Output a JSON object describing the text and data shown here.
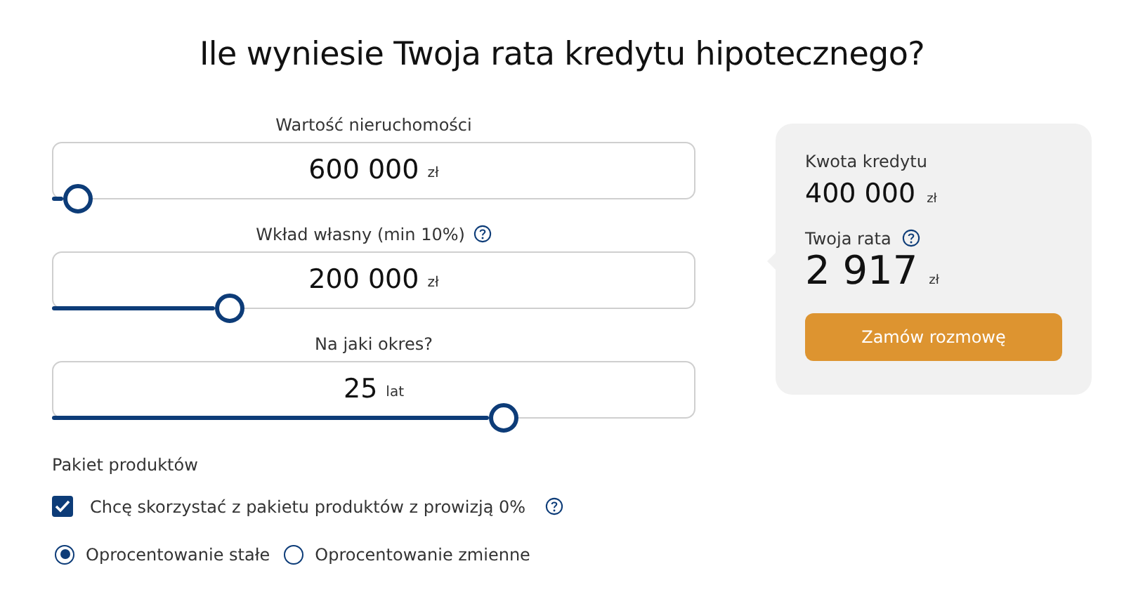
{
  "title": "Ile wyniesie Twoja rata kredytu hipotecznego?",
  "sliders": [
    {
      "label": "Wartość nieruchomości",
      "value": "600 000",
      "unit": "zł",
      "help": false,
      "level": 0.04
    },
    {
      "label": "Wkład własny (min 10%)",
      "value": "200 000",
      "unit": "zł",
      "help": true,
      "level": 0.275
    },
    {
      "label": "Na jaki okres?",
      "value": "25",
      "unit": "lat",
      "help": false,
      "level": 0.7
    }
  ],
  "package": {
    "heading": "Pakiet produktów",
    "label": "Chcę skorzystać z pakietu produktów z prowizją 0%",
    "checked": true,
    "help": true
  },
  "rate_type": [
    {
      "label": "Oprocentowanie stałe",
      "selected": true
    },
    {
      "label": "Oprocentowanie zmienne",
      "selected": false
    }
  ],
  "summary": {
    "loan_label": "Kwota kredytu",
    "loan_value": "400 000",
    "loan_unit": "zł",
    "rate_label": "Twoja rata",
    "rate_help": true,
    "rate_value": "2 917",
    "rate_unit": "zł",
    "button": "Zamów rozmowę"
  }
}
